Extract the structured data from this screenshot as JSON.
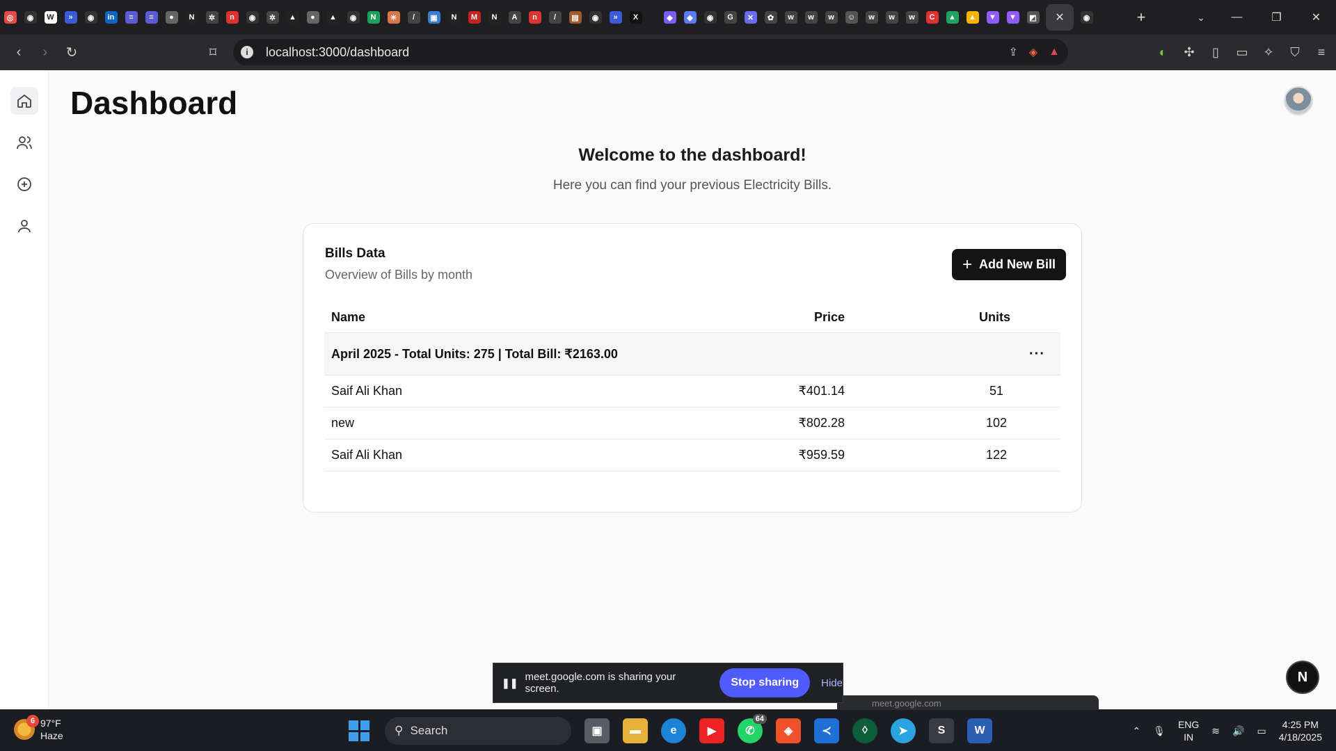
{
  "browser": {
    "url": "localhost:3000/dashboard",
    "tab_favicons": [
      {
        "name": "favicon-1",
        "color": "#e64a4a",
        "glyph": "◎"
      },
      {
        "name": "github",
        "color": "#333",
        "glyph": "◉"
      },
      {
        "name": "w-app",
        "color": "#fff",
        "glyph": "W"
      },
      {
        "name": "arrow-app",
        "color": "#3b5bdb",
        "glyph": "»"
      },
      {
        "name": "github",
        "color": "#333",
        "glyph": "◉"
      },
      {
        "name": "linkedin",
        "color": "#0a66c2",
        "glyph": "in"
      },
      {
        "name": "list-app",
        "color": "#5b5bd6",
        "glyph": "≡"
      },
      {
        "name": "list-app",
        "color": "#5b5bd6",
        "glyph": "≡"
      },
      {
        "name": "globe",
        "color": "#666",
        "glyph": "●"
      },
      {
        "name": "notion",
        "color": "#222",
        "glyph": "N"
      },
      {
        "name": "openai",
        "color": "#444",
        "glyph": "✲"
      },
      {
        "name": "red-app",
        "color": "#d33",
        "glyph": "n"
      },
      {
        "name": "github",
        "color": "#333",
        "glyph": "◉"
      },
      {
        "name": "openai",
        "color": "#444",
        "glyph": "✲"
      },
      {
        "name": "vercel",
        "color": "#222",
        "glyph": "▲"
      },
      {
        "name": "globe",
        "color": "#666",
        "glyph": "●"
      },
      {
        "name": "vercel",
        "color": "#222",
        "glyph": "▲"
      },
      {
        "name": "github",
        "color": "#333",
        "glyph": "◉"
      },
      {
        "name": "green-app",
        "color": "#1aa35b",
        "glyph": "N"
      },
      {
        "name": "claude",
        "color": "#d9774b",
        "glyph": "✳"
      },
      {
        "name": "slash-app",
        "color": "#444",
        "glyph": "/"
      },
      {
        "name": "image-app",
        "color": "#3a7bd5",
        "glyph": "▣"
      },
      {
        "name": "notion",
        "color": "#222",
        "glyph": "N"
      },
      {
        "name": "gmail",
        "color": "#c5221f",
        "glyph": "M"
      },
      {
        "name": "notion",
        "color": "#222",
        "glyph": "N"
      },
      {
        "name": "a-app",
        "color": "#444",
        "glyph": "A"
      },
      {
        "name": "red-app",
        "color": "#d33",
        "glyph": "n"
      },
      {
        "name": "slash-app",
        "color": "#444",
        "glyph": "/"
      },
      {
        "name": "code-app",
        "color": "#a05a2c",
        "glyph": "▤"
      },
      {
        "name": "github",
        "color": "#333",
        "glyph": "◉"
      },
      {
        "name": "arrow-app",
        "color": "#3b5bdb",
        "glyph": "»"
      },
      {
        "name": "x",
        "color": "#111",
        "glyph": "X"
      }
    ],
    "tab_favicons_2": [
      {
        "name": "shield-app",
        "color": "#7b5cf0",
        "glyph": "◆"
      },
      {
        "name": "shield-app",
        "color": "#5b7bf0",
        "glyph": "◆"
      },
      {
        "name": "github",
        "color": "#333",
        "glyph": "◉"
      },
      {
        "name": "google",
        "color": "#444",
        "glyph": "G"
      },
      {
        "name": "x-app",
        "color": "#6a6af0",
        "glyph": "✕"
      },
      {
        "name": "gear-app",
        "color": "#444",
        "glyph": "✿"
      },
      {
        "name": "w-app",
        "color": "#444",
        "glyph": "w"
      },
      {
        "name": "w-app",
        "color": "#444",
        "glyph": "w"
      },
      {
        "name": "w-app",
        "color": "#444",
        "glyph": "w"
      },
      {
        "name": "avatar-app",
        "color": "#555",
        "glyph": "☺"
      },
      {
        "name": "w-app",
        "color": "#444",
        "glyph": "w"
      },
      {
        "name": "w-app",
        "color": "#444",
        "glyph": "w"
      },
      {
        "name": "w-app",
        "color": "#444",
        "glyph": "w"
      },
      {
        "name": "c-app",
        "color": "#d33",
        "glyph": "C"
      },
      {
        "name": "drive",
        "color": "#1fa463",
        "glyph": "▲"
      },
      {
        "name": "drive",
        "color": "#f4b400",
        "glyph": "▲"
      },
      {
        "name": "vite",
        "color": "#8f5cf7",
        "glyph": "▼"
      },
      {
        "name": "vite",
        "color": "#8f5cf7",
        "glyph": "▼"
      },
      {
        "name": "puzzle-app",
        "color": "#555",
        "glyph": "◩"
      }
    ]
  },
  "sidebar": {
    "items": [
      {
        "name": "home"
      },
      {
        "name": "users"
      },
      {
        "name": "add"
      },
      {
        "name": "profile"
      }
    ]
  },
  "page": {
    "title": "Dashboard",
    "welcome": "Welcome to the dashboard!",
    "subtitle": "Here you can find your previous Electricity Bills."
  },
  "card": {
    "title": "Bills Data",
    "description": "Overview of Bills by month",
    "add_button": "Add New Bill",
    "columns": {
      "name": "Name",
      "price": "Price",
      "units": "Units"
    },
    "group_label": "April 2025 - Total Units: 275 | Total Bill: ₹2163.00",
    "rows": [
      {
        "name": "Saif Ali Khan",
        "price": "₹401.14",
        "units": "51"
      },
      {
        "name": "new",
        "price": "₹802.28",
        "units": "102"
      },
      {
        "name": "Saif Ali Khan",
        "price": "₹959.59",
        "units": "122"
      }
    ]
  },
  "share_bar": {
    "message": "meet.google.com is sharing your screen.",
    "stop": "Stop sharing",
    "hide": "Hide",
    "peek": "meet.google.com"
  },
  "floating_badge": "N",
  "taskbar": {
    "weather_badge": "6",
    "temperature": "97°F",
    "condition": "Haze",
    "search_label": "Search",
    "whatsapp_badge": "64",
    "lang_1": "ENG",
    "lang_2": "IN",
    "time": "4:25 PM",
    "date": "4/18/2025"
  }
}
